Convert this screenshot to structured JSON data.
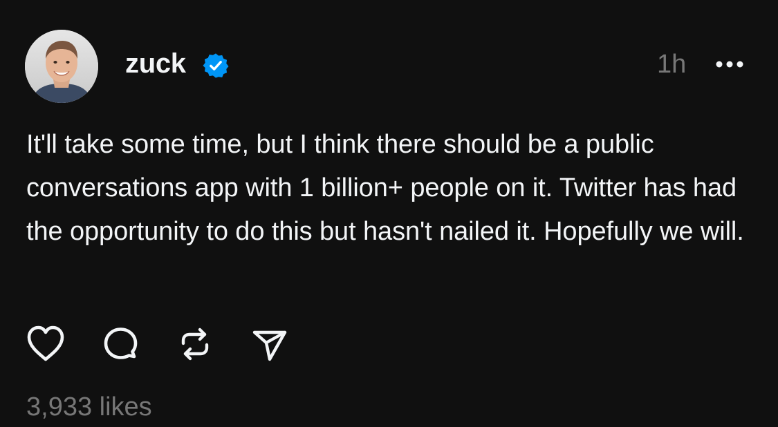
{
  "post": {
    "author": {
      "username": "zuck",
      "verified": true,
      "avatar_icon": "profile-photo"
    },
    "timestamp": "1h",
    "more_icon": "ellipsis-icon",
    "text": "It'll take some time, but I think there should be a public conversations app with 1 billion+ people on it. Twitter has had the opportunity to do this but hasn't nailed it. Hopefully we will.",
    "actions": [
      {
        "name": "like",
        "icon": "heart-icon"
      },
      {
        "name": "reply",
        "icon": "comment-icon"
      },
      {
        "name": "repost",
        "icon": "repost-icon"
      },
      {
        "name": "share",
        "icon": "send-icon"
      }
    ],
    "likes": "3,933 likes"
  },
  "colors": {
    "background": "#101010",
    "primary_text": "#f3f5f7",
    "secondary_text": "#777777",
    "verified_badge": "#0095f6"
  }
}
